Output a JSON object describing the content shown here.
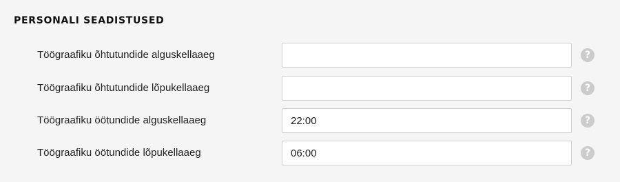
{
  "section": {
    "title": "PERSONALI SEADISTUSED"
  },
  "settings": [
    {
      "label": "Töögraafiku õhtutundide alguskellaaeg",
      "value": "",
      "help_icon": "question-mark"
    },
    {
      "label": "Töögraafiku õhtutundide lõpukellaaeg",
      "value": "",
      "help_icon": "question-mark"
    },
    {
      "label": "Töögraafiku öötundide alguskellaaeg",
      "value": "22:00",
      "help_icon": "question-mark"
    },
    {
      "label": "Töögraafiku öötundide lõpukellaaeg",
      "value": "06:00",
      "help_icon": "question-mark"
    }
  ],
  "help_glyph": "?"
}
